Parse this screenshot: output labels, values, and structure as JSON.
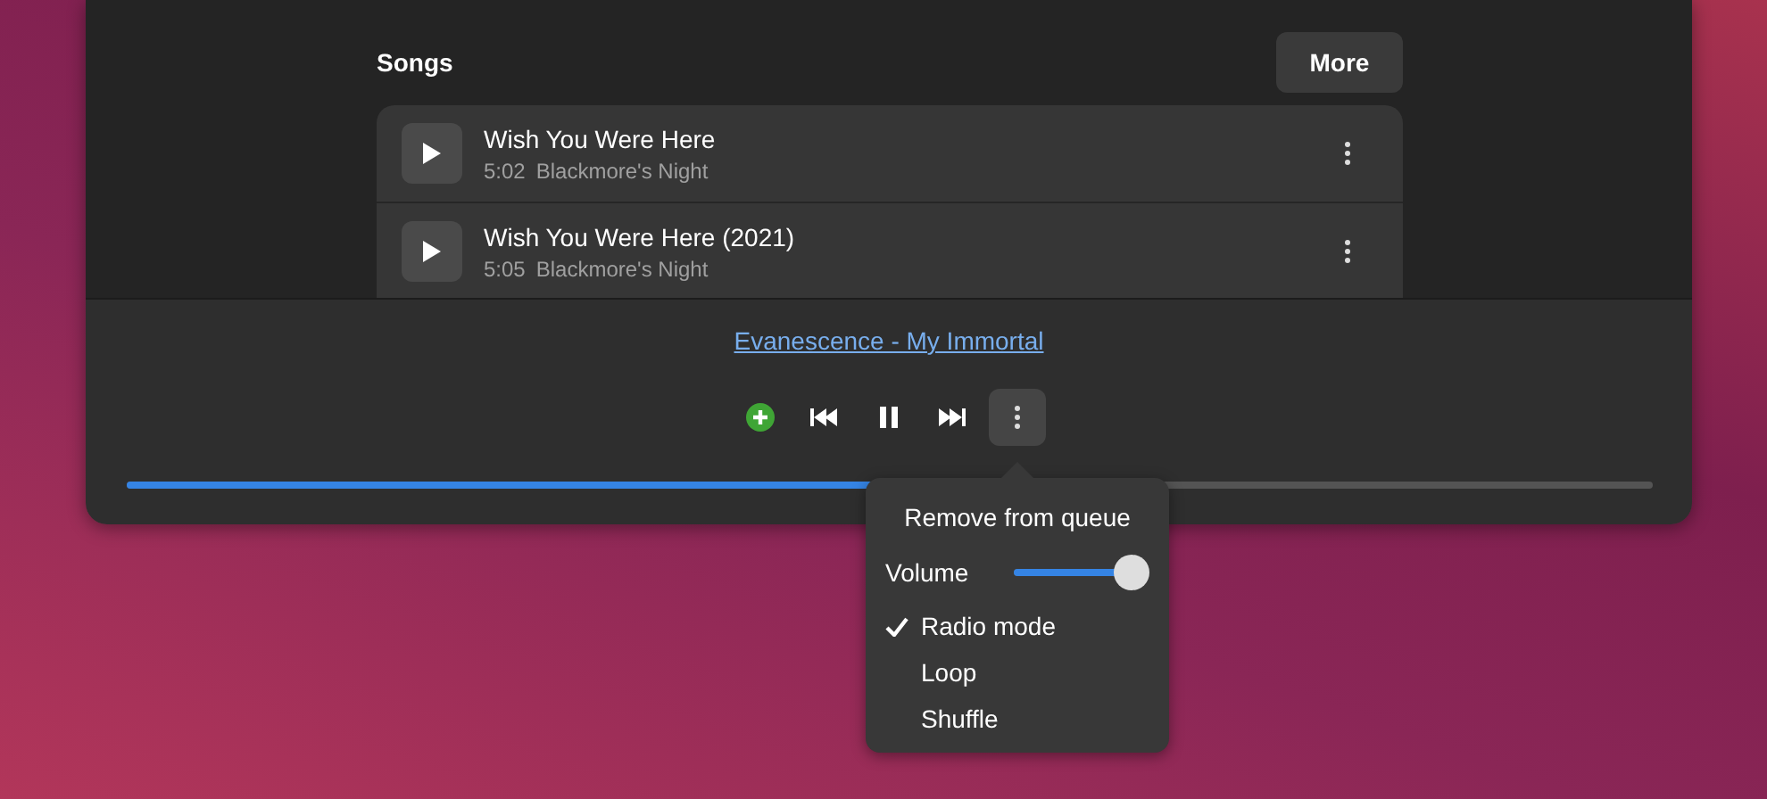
{
  "section": {
    "title": "Songs",
    "more_button": "More"
  },
  "songs": [
    {
      "title": "Wish You Were Here",
      "duration": "5:02",
      "artist": "Blackmore's Night"
    },
    {
      "title": "Wish You Were Here (2021)",
      "duration": "5:05",
      "artist": "Blackmore's Night"
    }
  ],
  "player": {
    "now_playing": "Evanescence - My Immortal",
    "progress": {
      "level": 0.49
    }
  },
  "menu": {
    "items": [
      {
        "kind": "action",
        "label": "Remove from queue"
      },
      {
        "kind": "slider",
        "label": "Volume",
        "level": 1
      },
      {
        "kind": "check",
        "label": "Radio mode",
        "checked": true
      },
      {
        "kind": "check",
        "label": "Loop",
        "checked": false
      },
      {
        "kind": "check",
        "label": "Shuffle",
        "checked": false
      }
    ]
  }
}
